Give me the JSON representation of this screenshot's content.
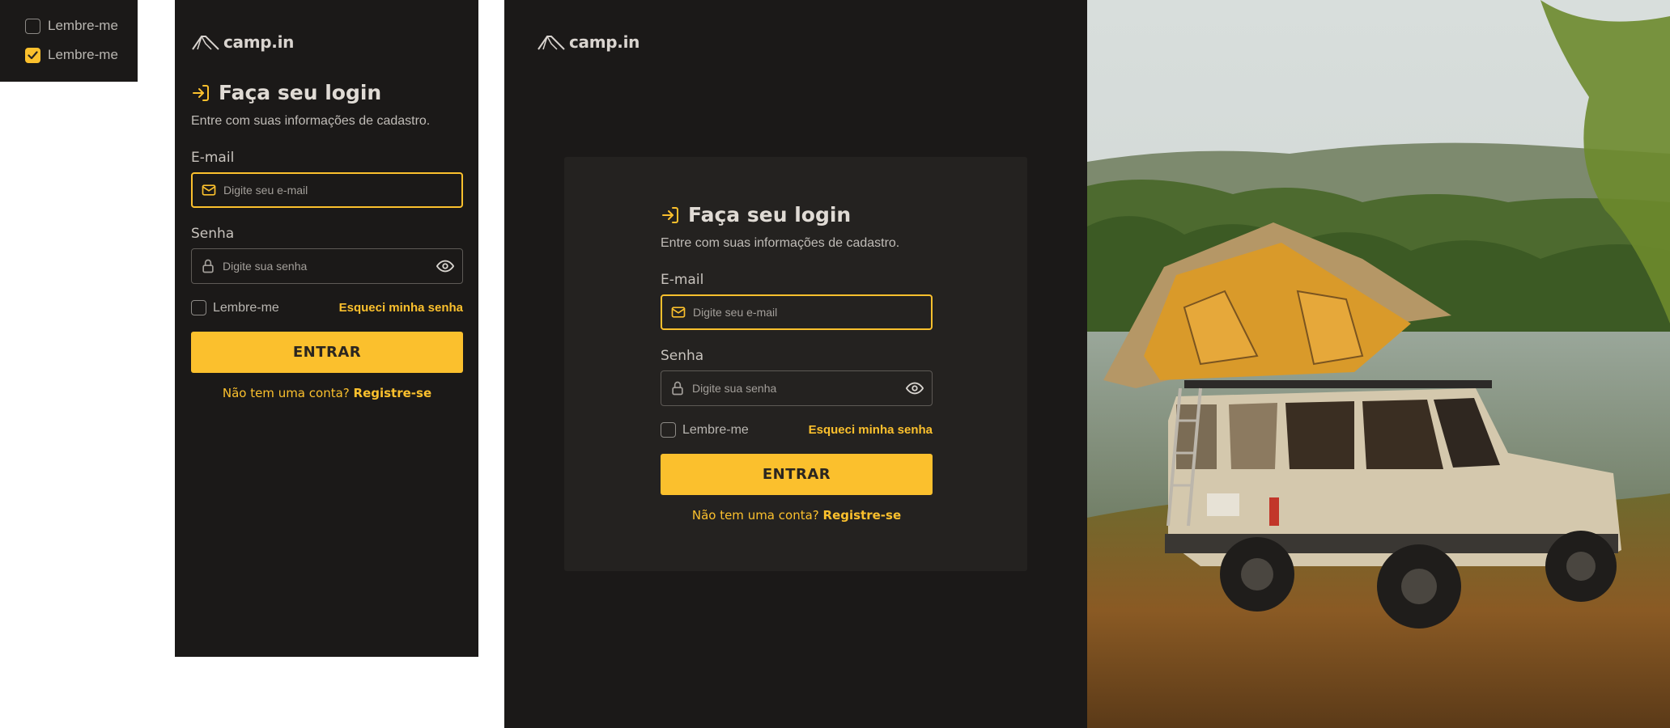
{
  "swatches": [
    {
      "label": "Lembre-me",
      "checked": false
    },
    {
      "label": "Lembre-me",
      "checked": true
    }
  ],
  "brand": {
    "name": "camp.in"
  },
  "login": {
    "title": "Faça seu login",
    "subtitle": "Entre com suas informações de cadastro.",
    "email_label": "E-mail",
    "email_placeholder": "Digite seu e-mail",
    "password_label": "Senha",
    "password_placeholder": "Digite sua senha",
    "remember_label": "Lembre-me",
    "forgot_label": "Esqueci minha senha",
    "submit_label": "ENTRAR",
    "no_account_text": "Não tem uma conta?",
    "register_label": "Registre-se"
  },
  "icons": {
    "login": "login-arrow-icon",
    "email": "mail-icon",
    "password": "lock-icon",
    "toggle_visibility": "eye-icon",
    "logo": "tent-logo-icon"
  },
  "colors": {
    "accent": "#fbc02d",
    "panel_bg": "#1b1918",
    "card_bg": "#242220",
    "text_light": "#e0dbd5"
  }
}
